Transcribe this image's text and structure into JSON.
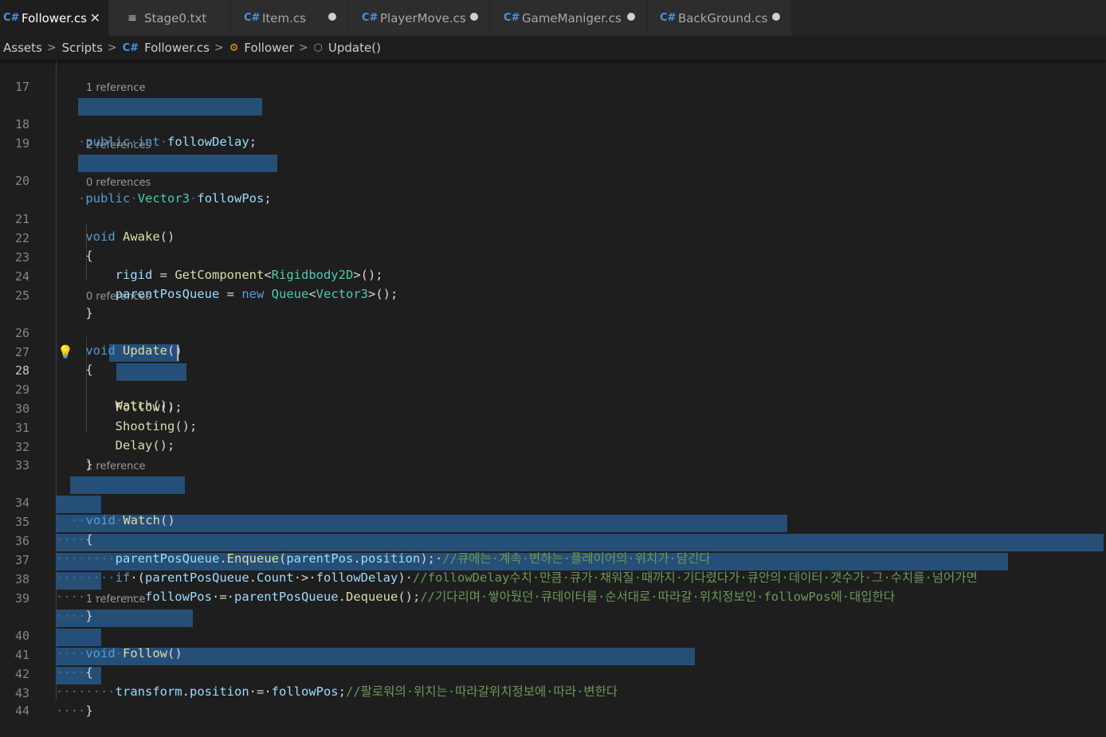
{
  "tabs": [
    {
      "label": "Follower.cs",
      "icon": "csharp-file-icon",
      "active": true,
      "close": "✕"
    },
    {
      "label": "Stage0.txt",
      "icon": "text-file-icon",
      "active": false
    },
    {
      "label": "Item.cs",
      "icon": "csharp-file-icon",
      "active": false,
      "modified": true
    },
    {
      "label": "PlayerMove.cs",
      "icon": "csharp-file-icon",
      "active": false,
      "modified": true
    },
    {
      "label": "GameManiger.cs",
      "icon": "csharp-file-icon",
      "active": false,
      "modified": true
    },
    {
      "label": "BackGround.cs",
      "icon": "csharp-file-icon",
      "active": false,
      "modified": true
    }
  ],
  "breadcrumb": [
    "Assets",
    "Scripts",
    "Follower.cs",
    "Follower",
    "Update()"
  ],
  "editor": {
    "current_line": 28,
    "lines": [
      {
        "n": "17",
        "lens": ""
      },
      {
        "n": "18",
        "lens": "1 reference"
      },
      {
        "n": "19",
        "lens": ""
      },
      {
        "n": "20",
        "lens": "2 references"
      },
      {
        "n": "21",
        "lens": "0 references"
      },
      {
        "n": "22",
        "lens": ""
      },
      {
        "n": "23",
        "lens": ""
      },
      {
        "n": "24",
        "lens": ""
      },
      {
        "n": "25",
        "lens": ""
      },
      {
        "n": "26",
        "lens": "0 references"
      },
      {
        "n": "27",
        "lens": ""
      },
      {
        "n": "28",
        "lens": ""
      },
      {
        "n": "29",
        "lens": ""
      },
      {
        "n": "30",
        "lens": ""
      },
      {
        "n": "31",
        "lens": ""
      },
      {
        "n": "32",
        "lens": ""
      },
      {
        "n": "33",
        "lens": ""
      },
      {
        "n": "34",
        "lens": "1 reference"
      },
      {
        "n": "35",
        "lens": ""
      },
      {
        "n": "36",
        "lens": ""
      },
      {
        "n": "37",
        "lens": ""
      },
      {
        "n": "38",
        "lens": ""
      },
      {
        "n": "39",
        "lens": ""
      },
      {
        "n": "40",
        "lens": "1 reference"
      },
      {
        "n": "41",
        "lens": ""
      },
      {
        "n": "42",
        "lens": ""
      },
      {
        "n": "43",
        "lens": ""
      },
      {
        "n": "44",
        "lens": ""
      }
    ],
    "code": {
      "l18": [
        "",
        "public",
        "·",
        "int",
        "·",
        "followDelay",
        ";"
      ],
      "l20": [
        "",
        "public",
        "·",
        "Vector3",
        "·",
        "followPos",
        ";"
      ],
      "l21": [
        "    ",
        "void",
        " ",
        "Awake",
        "()"
      ],
      "l22": [
        "    ",
        "{"
      ],
      "l23": [
        "        ",
        "rigid",
        " = ",
        "GetComponent",
        "<",
        "Rigidbody2D",
        ">();"
      ],
      "l24": [
        "        ",
        "parentPosQueue",
        " = ",
        "new",
        " ",
        "Queue",
        "<",
        "Vector3",
        ">();"
      ],
      "l25": [
        "    ",
        "}"
      ],
      "l26": [
        "    ",
        "void",
        " ",
        "Update",
        "()"
      ],
      "l27": [
        "    ",
        "{"
      ],
      "l28": [
        "        ",
        "Watch",
        "();"
      ],
      "l29": [
        "        ",
        "Follow",
        "();"
      ],
      "l30": [
        "        ",
        "Shooting",
        "();"
      ],
      "l31": [
        "        ",
        "Delay",
        "();"
      ],
      "l32": [
        "    ",
        "}"
      ],
      "l34": [
        "··",
        "void",
        "·",
        "Watch",
        "()"
      ],
      "l35": [
        "····",
        "{"
      ],
      "l36": [
        "········",
        "parentPosQueue",
        ".",
        "Enqueue",
        "(",
        "parentPos",
        ".",
        "position",
        ");·",
        "//큐에는·계속·변하는·플레이어의·위치가·담긴다"
      ],
      "l37": [
        "········",
        "if",
        "·(",
        "parentPosQueue",
        ".",
        "Count",
        "·>·",
        "followDelay",
        ")·",
        "//followDelay수치·만큼·큐가·채워질·때까지·기다렸다가·큐안의·데이터·갯수가·그·수치를·넘어가면"
      ],
      "l38": [
        "············",
        "followPos",
        "·=·",
        "parentPosQueue",
        ".",
        "Dequeue",
        "();",
        "//기다리며·쌓아뒀던·큐데이터를·순서대로·따라갈·위치정보인·followPos에·대입한다"
      ],
      "l39": [
        "····",
        "}"
      ],
      "l40": [
        "····",
        "void",
        "·",
        "Follow",
        "()"
      ],
      "l41": [
        "····",
        "{"
      ],
      "l42": [
        "········",
        "transform",
        ".",
        "position",
        "·=·",
        "followPos",
        ";",
        "//팔로워의·위치는·따라갈위치정보에·따라·변한다"
      ],
      "l43": [
        "····",
        "}"
      ]
    }
  }
}
